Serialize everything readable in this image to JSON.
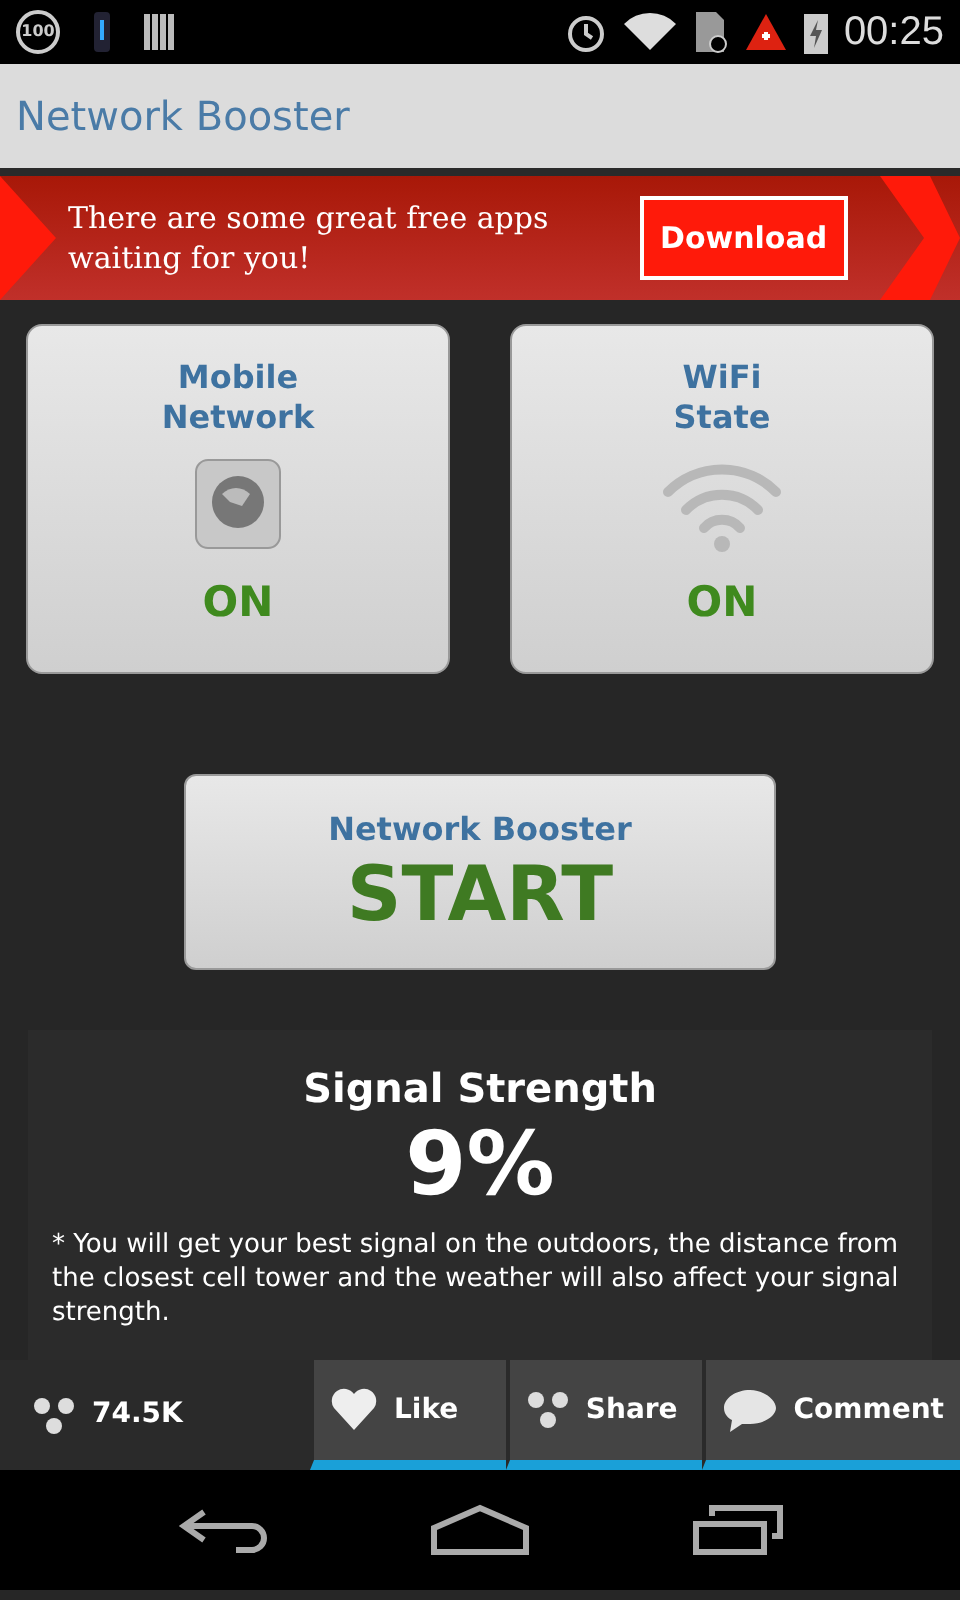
{
  "status_bar": {
    "battery_percent_badge": "100",
    "time": "00:25"
  },
  "window": {
    "title": "Network Booster"
  },
  "ad": {
    "text": "There are some great free apps waiting for you!",
    "button": "Download"
  },
  "tiles": [
    {
      "kind": "mobile",
      "title": "Mobile Network",
      "state": "ON",
      "on": true
    },
    {
      "kind": "wifi",
      "title": "WiFi State",
      "state": "ON",
      "on": true
    }
  ],
  "booster": {
    "title": "Network Booster",
    "action": "START"
  },
  "signal": {
    "title": "Signal Strength",
    "value": "9%",
    "note": "* You will get your best signal on the outdoors, the distance from the closest cell tower and the weather will also affect your signal strength."
  },
  "social": {
    "count": "74.5K",
    "buttons": [
      {
        "kind": "like",
        "label": "Like"
      },
      {
        "kind": "share",
        "label": "Share"
      },
      {
        "kind": "comment",
        "label": "Comment"
      }
    ]
  }
}
